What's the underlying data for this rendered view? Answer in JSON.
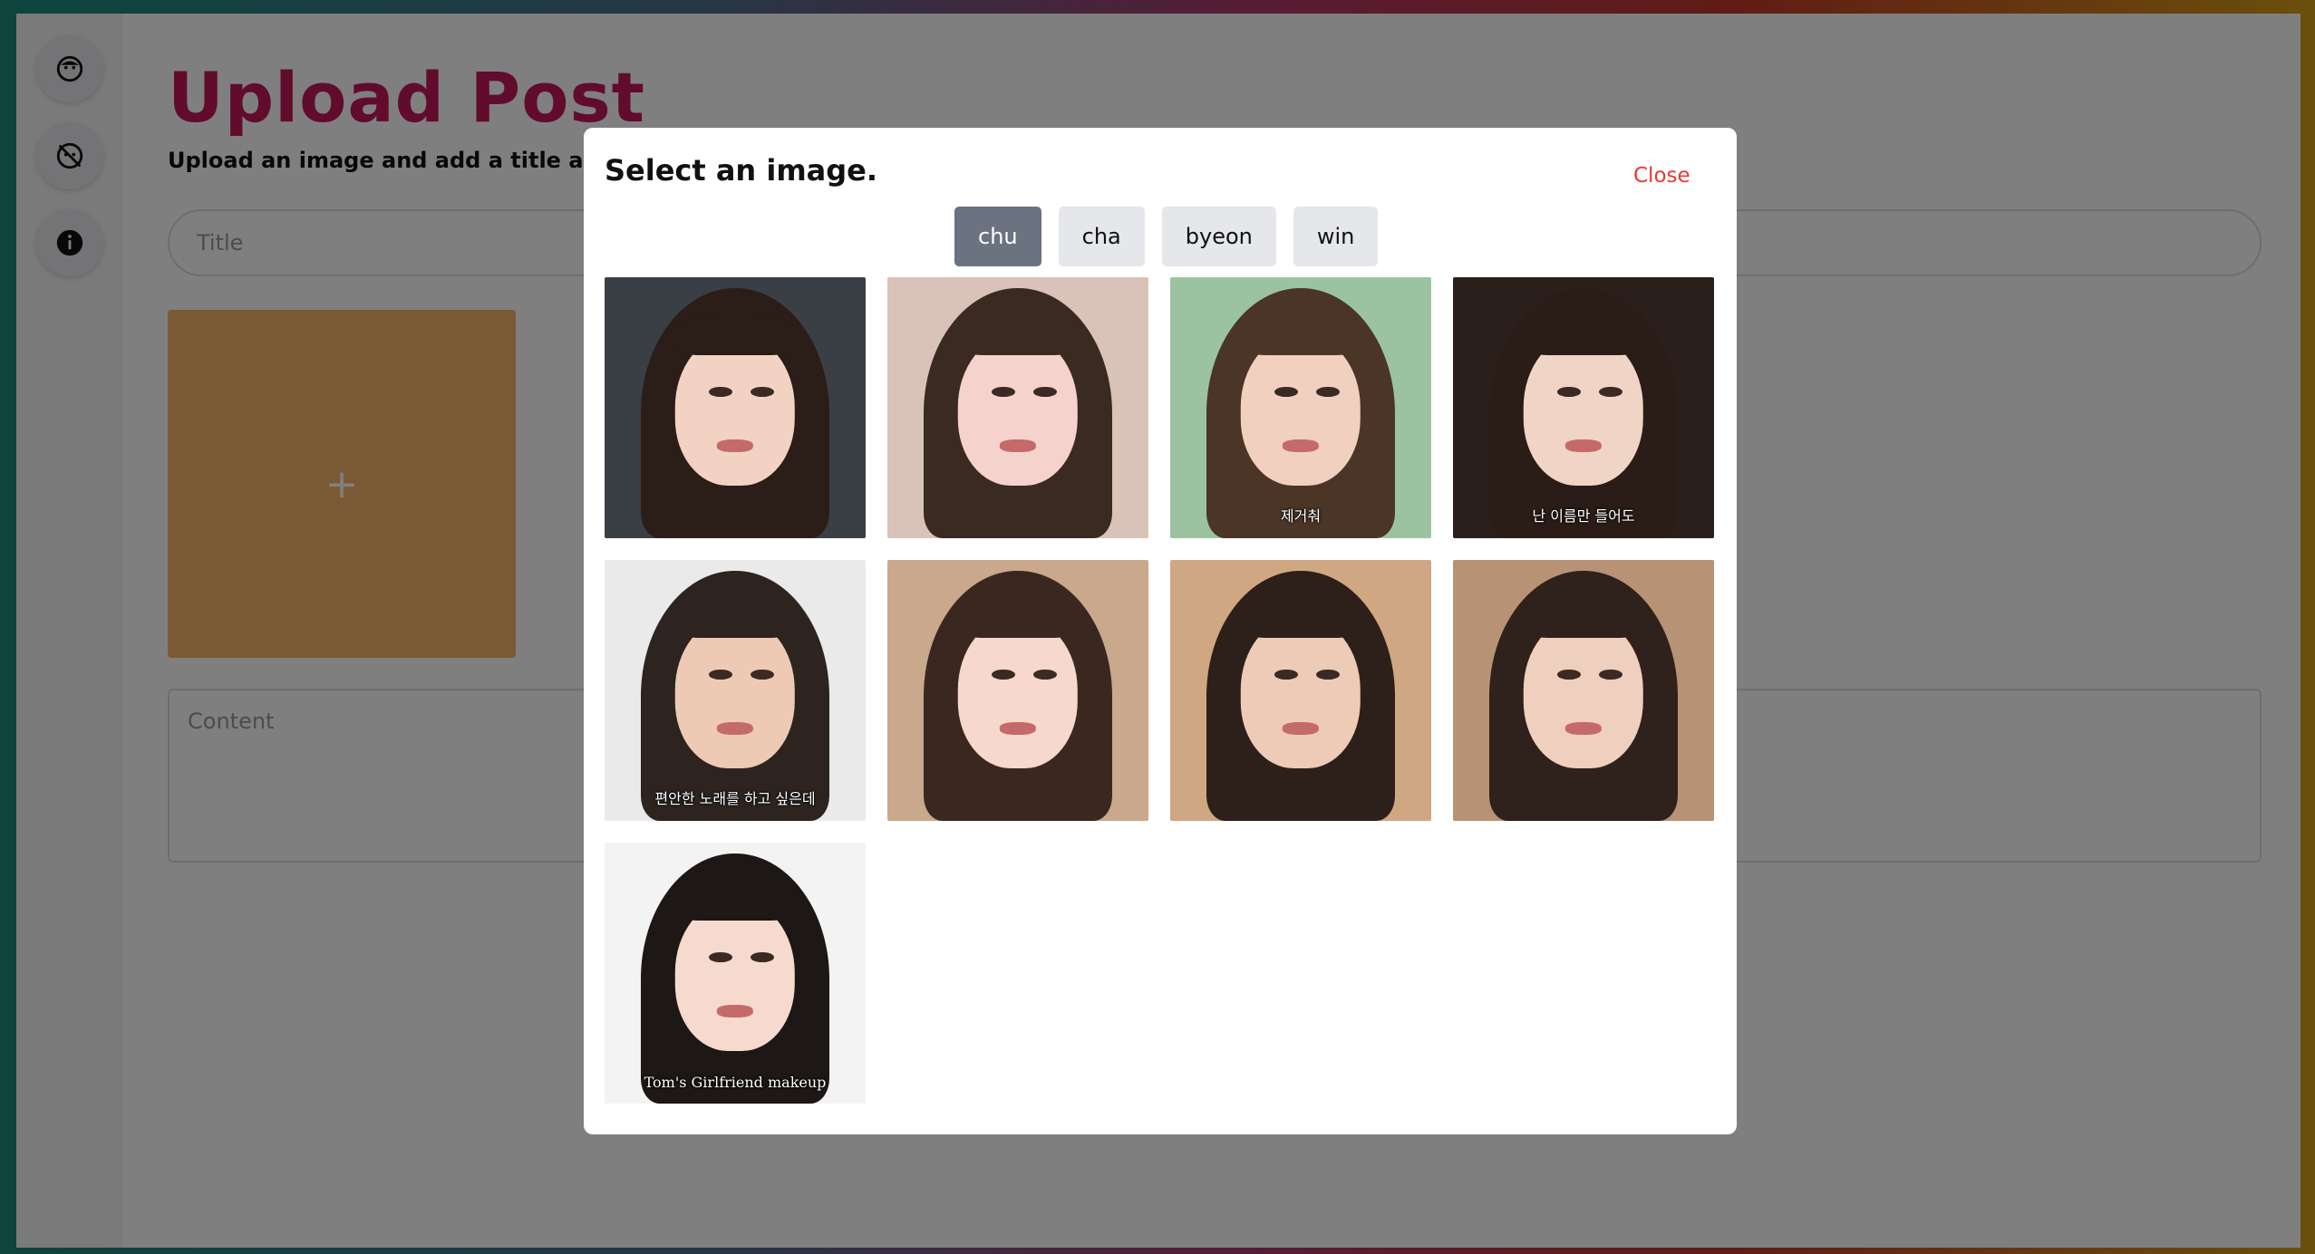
{
  "page": {
    "title": "Upload Post",
    "subtitle": "Upload an image and add a title and co",
    "title_placeholder": "Title",
    "content_placeholder": "Content",
    "upload_plus": "+"
  },
  "sidebar": {
    "items": [
      {
        "icon": "face-icon"
      },
      {
        "icon": "eye-off-icon"
      },
      {
        "icon": "info-icon"
      }
    ]
  },
  "modal": {
    "title": "Select an image.",
    "close_label": "Close",
    "tabs": [
      {
        "label": "chu",
        "active": true
      },
      {
        "label": "cha",
        "active": false
      },
      {
        "label": "byeon",
        "active": false
      },
      {
        "label": "win",
        "active": false
      }
    ],
    "images": [
      {
        "caption": "",
        "bg": "#3a3f45",
        "hair": "#2b1d17",
        "skin": "#f2d3c3"
      },
      {
        "caption": "",
        "bg": "#d9c2b8",
        "hair": "#3b2a22",
        "skin": "#f5d2cb"
      },
      {
        "caption": "제거춰",
        "bg": "#9cc3a0",
        "hair": "#4a3527",
        "skin": "#f1d0c0"
      },
      {
        "caption": "난 이름만 들어도",
        "bg": "#2a1f1a",
        "hair": "#2a1d17",
        "skin": "#f0d4c6"
      },
      {
        "caption": "편안한 노래를 하고 싶은데",
        "bg": "#eaeaea",
        "hair": "#2d2420",
        "skin": "#eecab5"
      },
      {
        "caption": "",
        "bg": "#c9a88c",
        "hair": "#3a2820",
        "skin": "#f6d9cc"
      },
      {
        "caption": "",
        "bg": "#cfa782",
        "hair": "#2d201b",
        "skin": "#eecbb7"
      },
      {
        "caption": "",
        "bg": "#b89274",
        "hair": "#2f211b",
        "skin": "#efcfbd"
      },
      {
        "caption": "Tom's Girlfriend makeup",
        "bg": "#f3f3f3",
        "hair": "#1d1716",
        "skin": "#f5dacd"
      }
    ]
  }
}
